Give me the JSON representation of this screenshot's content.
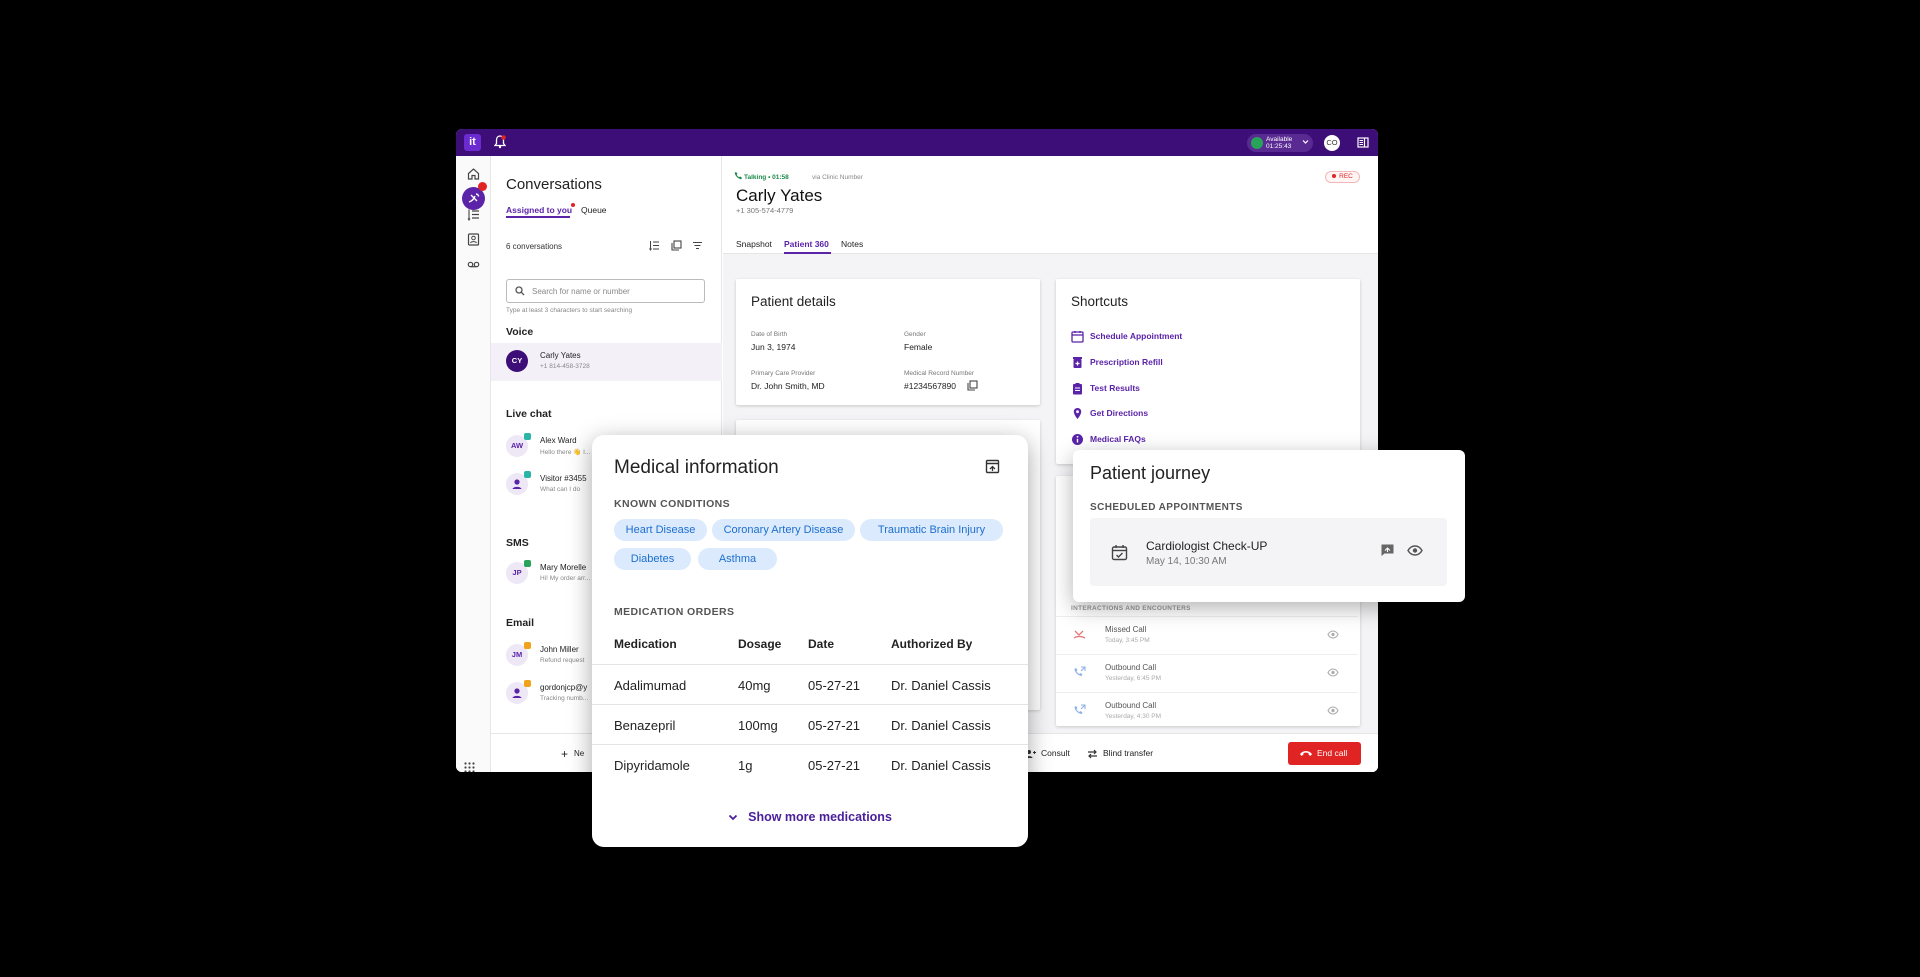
{
  "topbar": {
    "logo": "it",
    "status_line1": "Available",
    "status_line2": "01:25:43",
    "avatar": "CO"
  },
  "conversations": {
    "title": "Conversations",
    "tabs": [
      "Assigned to you",
      "Queue"
    ],
    "count": "6 conversations",
    "search_placeholder": "Search for name or number",
    "search_hint": "Type at least 3 characters to start searching",
    "sections": {
      "voice": "Voice",
      "live_chat": "Live chat",
      "sms": "SMS",
      "email": "Email"
    },
    "voice": [
      {
        "initials": "CY",
        "name": "Carly Yates",
        "sub": "+1 814-458-3728"
      }
    ],
    "live_chat": [
      {
        "initials": "AW",
        "name": "Alex Ward",
        "sub": "Hello there 👋 I..."
      },
      {
        "initials": "",
        "name": "Visitor #3455",
        "sub": "What can I do"
      }
    ],
    "sms": [
      {
        "initials": "JP",
        "name": "Mary Morelle",
        "sub": "Hi! My order arr..."
      }
    ],
    "email": [
      {
        "initials": "JM",
        "name": "John Miller",
        "sub": "Refund request"
      },
      {
        "initials": "",
        "name": "gordonjcp@y",
        "sub": "Tracking numb..."
      }
    ],
    "new_label": "Ne"
  },
  "call": {
    "status": "Talking • 01:58",
    "via": "via Clinic Number",
    "name": "Carly Yates",
    "phone": "+1 305-574-4779",
    "rec": "REC",
    "tabs": [
      "Snapshot",
      "Patient 360",
      "Notes"
    ]
  },
  "patient_details": {
    "title": "Patient details",
    "dob_label": "Date of Birth",
    "dob": "Jun 3, 1974",
    "gender_label": "Gender",
    "gender": "Female",
    "pcp_label": "Primary Care Provider",
    "pcp": "Dr. John Smith, MD",
    "mrn_label": "Medical Record Number",
    "mrn": "#1234567890"
  },
  "shortcuts": {
    "title": "Shortcuts",
    "items": [
      {
        "label": "Schedule Appointment",
        "icon": "calendar-icon"
      },
      {
        "label": "Prescription Refill",
        "icon": "prescription-icon"
      },
      {
        "label": "Test Results",
        "icon": "clipboard-icon"
      },
      {
        "label": "Get Directions",
        "icon": "location-pin-icon"
      },
      {
        "label": "Medical FAQs",
        "icon": "info-icon"
      }
    ]
  },
  "interactions": {
    "header": "INTERACTIONS AND ENCOUNTERS",
    "rows": [
      {
        "name": "Missed Call",
        "time": "Today, 3:45 PM"
      },
      {
        "name": "Outbound Call",
        "time": "Yesterday, 6:45 PM"
      },
      {
        "name": "Outbound Call",
        "time": "Yesterday, 4:30 PM"
      }
    ]
  },
  "callbar": {
    "consult": "Consult",
    "blind_transfer": "Blind transfer",
    "end_call": "End call"
  },
  "medical_info": {
    "title": "Medical information",
    "known_conditions_label": "KNOWN CONDITIONS",
    "conditions": [
      "Heart Disease",
      "Coronary Artery Disease",
      "Traumatic Brain Injury",
      "Diabetes",
      "Asthma"
    ],
    "medication_orders_label": "MEDICATION ORDERS",
    "columns": [
      "Medication",
      "Dosage",
      "Date",
      "Authorized By"
    ],
    "rows": [
      [
        "Adalimumad",
        "40mg",
        "05-27-21",
        "Dr. Daniel Cassis"
      ],
      [
        "Benazepril",
        "100mg",
        "05-27-21",
        "Dr. Daniel Cassis"
      ],
      [
        "Dipyridamole",
        "1g",
        "05-27-21",
        "Dr. Daniel Cassis"
      ]
    ],
    "show_more": "Show more medications"
  },
  "patient_journey": {
    "title": "Patient journey",
    "scheduled_label": "SCHEDULED APPOINTMENTS",
    "appointment": {
      "name": "Cardiologist Check-UP",
      "date": "May 14, 10:30 AM"
    }
  },
  "colors": {
    "brand": "#3d0d78",
    "accent": "#5a23a8",
    "danger": "#e02424",
    "chip": "#dbeafc"
  }
}
